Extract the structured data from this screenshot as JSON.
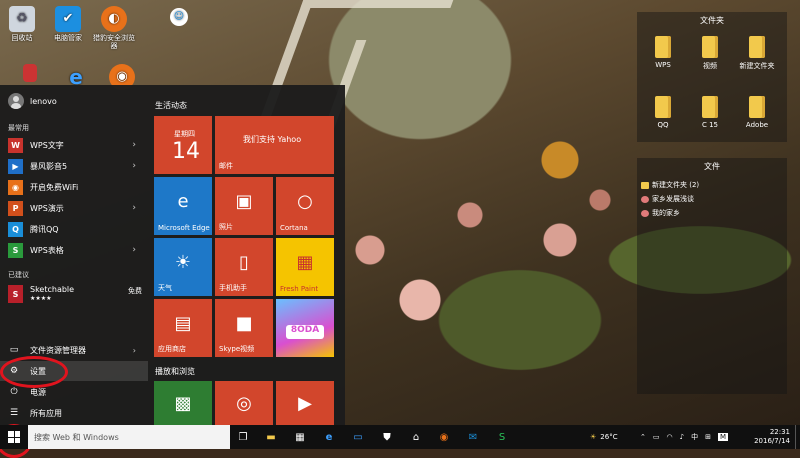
{
  "desktop": {
    "icons": [
      {
        "label": "回收站",
        "icon": "recycle-bin-icon"
      },
      {
        "label": "电脑管家",
        "icon": "shield-icon"
      },
      {
        "label": "猎豹安全浏览器",
        "icon": "cheetah-browser-icon"
      },
      {
        "label": "",
        "icon": "mascot-icon"
      }
    ],
    "fence_top": {
      "title": "文件夹",
      "items": [
        "WPS",
        "视频",
        "新建文件夹",
        "QQ",
        "C 15",
        "Adobe"
      ]
    },
    "fence_bottom": {
      "title": "文件",
      "items": [
        "新建文件夹 (2)",
        "家乡发展浅谈",
        "我的家乡"
      ]
    }
  },
  "start_menu": {
    "user": "lenovo",
    "most_used_header": "最常用",
    "most_used": [
      {
        "label": "WPS文字",
        "icon": "W",
        "color": "#c8332d"
      },
      {
        "label": "暴风影音5",
        "icon": "▶",
        "color": "#1f6fc8"
      },
      {
        "label": "开启免费WiFi",
        "icon": "◉",
        "color": "#e8711a"
      },
      {
        "label": "WPS演示",
        "icon": "P",
        "color": "#d2501c"
      },
      {
        "label": "腾讯QQ",
        "icon": "Q",
        "color": "#1a8ed8"
      },
      {
        "label": "WPS表格",
        "icon": "S",
        "color": "#2a9a3c"
      }
    ],
    "suggested_header": "已建议",
    "suggested": {
      "label": "Sketchable",
      "badge": "免费",
      "rating": "★★★★"
    },
    "system": [
      {
        "label": "文件资源管理器",
        "icon": "folder-icon"
      },
      {
        "label": "设置",
        "icon": "gear-icon"
      },
      {
        "label": "电源",
        "icon": "power-icon"
      },
      {
        "label": "所有应用",
        "icon": "list-icon"
      }
    ],
    "groups": [
      "生活动态",
      "播放和浏览"
    ],
    "tiles": {
      "calendar_day": "星期四",
      "calendar_date": "14",
      "mail_title": "我们支持 Yahoo",
      "mail_label": "邮件",
      "edge": "Microsoft Edge",
      "photos": "照片",
      "cortana": "Cortana",
      "weather": "天气",
      "phone": "手机助手",
      "freshpaint": "Fresh Paint",
      "store": "应用商店",
      "skype": "Skype视频",
      "game_badge": "8ODA"
    }
  },
  "taskbar": {
    "search_placeholder": "搜索 Web 和 Windows",
    "temperature": "26°C",
    "ime": "中",
    "ime2": "M",
    "time": "22:31",
    "date": "2016/7/14"
  },
  "colors": {
    "tile_orange": "#d2462c",
    "tile_blue": "#1e78c8",
    "annotation": "#e0141e"
  }
}
